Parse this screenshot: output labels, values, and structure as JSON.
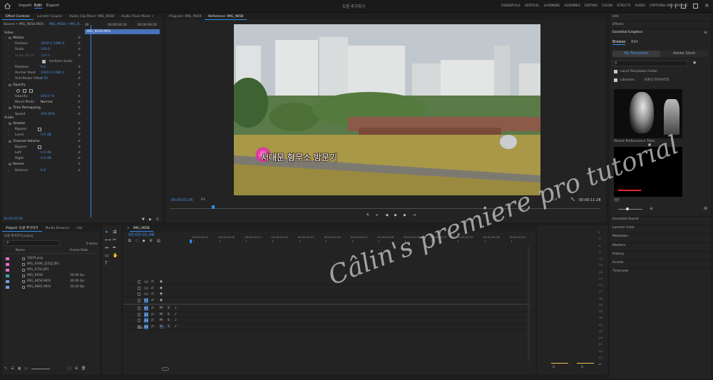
{
  "topbar": {
    "menu": [
      "Import",
      "Edit",
      "Export"
    ],
    "active_menu": "Edit",
    "project_title": "도원 추가하기",
    "workspaces": [
      "ESSENTIALS",
      "VERTICAL",
      "LEARNING",
      "ASSEMBLY",
      "EDITING",
      "COLOR",
      "EFFECTS",
      "AUDIO",
      "CAPTIONS AND GRAPHIC"
    ]
  },
  "effect_controls": {
    "tabs": [
      "Effect Controls",
      "Lumetri Scopes",
      "Audio Clip Mixer: IMG_9658",
      "Audio Track Mixer: I"
    ],
    "source": "Source • IMG_9658.MOV",
    "sequence": "IMG_9658 • IMG_9...",
    "time_start": "00",
    "time_mid": "00:00:04:24",
    "time_end": "00:00:09:29",
    "clip_name": "IMG_9658.MOV",
    "video_header": "Video",
    "rows": [
      {
        "label": "Motion",
        "value": "",
        "indent": 1,
        "fx": true
      },
      {
        "label": "Position",
        "value": "1920.0  1080.0",
        "indent": 3
      },
      {
        "label": "Scale",
        "value": "100.0",
        "indent": 3
      },
      {
        "label": "Scale Width",
        "value": "100.0",
        "indent": 3,
        "dim": true
      },
      {
        "label": "Uniform Scale",
        "value": "",
        "indent": 8,
        "check": true
      },
      {
        "label": "Rotation",
        "value": "0.0",
        "indent": 3
      },
      {
        "label": "Anchor Point",
        "value": "1920.0  1080.0",
        "indent": 3
      },
      {
        "label": "Anti-flicker Filter",
        "value": "0.00",
        "indent": 3
      },
      {
        "label": "Opacity",
        "value": "",
        "indent": 1,
        "fx": true
      },
      {
        "label": "",
        "value": "",
        "indent": 3,
        "masks": true
      },
      {
        "label": "Opacity",
        "value": "100.0 %",
        "indent": 3
      },
      {
        "label": "Blend Mode",
        "value": "Normal",
        "indent": 3
      },
      {
        "label": "Time Remapping",
        "value": "",
        "indent": 1,
        "fx": true
      },
      {
        "label": "Speed",
        "value": "100.00%",
        "indent": 3
      }
    ],
    "audio_header": "Audio",
    "audio_rows": [
      {
        "label": "Volume",
        "value": "",
        "indent": 1,
        "fx": true
      },
      {
        "label": "Bypass",
        "value": "",
        "indent": 3,
        "check": true
      },
      {
        "label": "Level",
        "value": "0.0 dB",
        "indent": 3
      },
      {
        "label": "Channel Volume",
        "value": "",
        "indent": 1,
        "fx": true
      },
      {
        "label": "Bypass",
        "value": "",
        "indent": 3,
        "check": true
      },
      {
        "label": "Left",
        "value": "0.0 dB",
        "indent": 3
      },
      {
        "label": "Right",
        "value": "0.0 dB",
        "indent": 3
      },
      {
        "label": "Panner",
        "value": "",
        "indent": 1,
        "fx": true
      },
      {
        "label": "Balance",
        "value": "0.0",
        "indent": 3
      }
    ],
    "footer_time": "00:00:01:06"
  },
  "program": {
    "tabs": [
      "Program: IMG_9658",
      "Reference: IMG_9658"
    ],
    "caption": "서대문 형무소 방문기",
    "timecode": "00:00:01:06",
    "fit": "Fit",
    "scale": "1/4",
    "duration": "00:00:11:28"
  },
  "right_panel": {
    "sections": [
      "Info",
      "Effects",
      "Essential Graphics"
    ],
    "tabs": [
      "Browse",
      "Edit"
    ],
    "subtabs": [
      "My Templates",
      "Adobe Stock"
    ],
    "local_templates": "Local Templates Folder",
    "libraries": "Libraries",
    "library_name": "조원의 라이브러리",
    "template1": "Fitness Performance Titles",
    "template2": "영문",
    "bottom_sections": [
      "Essential Sound",
      "Lumetri Color",
      "Metadata",
      "Markers",
      "History",
      "Events",
      "Timecode"
    ]
  },
  "project": {
    "tabs": [
      "Project: 도원 추가하기",
      "Media Browser",
      "Libr"
    ],
    "file": "도원 추가하기.prproj",
    "items_count": "6 items",
    "col_name": "Name",
    "col_rate": "Frame Rate",
    "items": [
      {
        "name": "자료파 png",
        "rate": "",
        "color": "#e070c8"
      },
      {
        "name": "IMG_9396_몽조합.JPG",
        "rate": "",
        "color": "#e070c8"
      },
      {
        "name": "IMG_9702.JPG",
        "rate": "",
        "color": "#e070c8"
      },
      {
        "name": "IMG_9658",
        "rate": "30.00 fps",
        "color": "#3aa8a8"
      },
      {
        "name": "IMG_9658.MOV",
        "rate": "30.00 fps",
        "color": "#7a9be0"
      },
      {
        "name": "IMG_9681.MOV",
        "rate": "30.00 fps",
        "color": "#7a9be0"
      }
    ]
  },
  "timeline": {
    "sequence_tab": "IMG_9658",
    "timecode": "00:00:01:06",
    "ruler_marks": [
      "00:00:04:15",
      "00:00:04:18",
      "00:00:04:21",
      "00:00:04:24",
      "00:00:04:27",
      "00:00:05:00",
      "00:00:05:03",
      "00:00:05:06",
      "00:00:05:09",
      "00:00:05:12",
      "00:00:05:15",
      "00:00:05:18",
      "00:00:05:21"
    ],
    "video_tracks": [
      "V4",
      "V3",
      "V2",
      "V1"
    ],
    "audio_tracks": [
      "A1",
      "A2",
      "A3",
      "A4"
    ],
    "mix_label": "Mix",
    "mix_value": "0.0"
  },
  "audio_meter": {
    "scale": [
      "0",
      "-3",
      "-6",
      "-9",
      "-12",
      "-15",
      "-18",
      "-21",
      "-24",
      "-27",
      "-30",
      "-33",
      "-36",
      "-39",
      "-42",
      "-45",
      "-48",
      "-51",
      "-54",
      "-57",
      "dB"
    ],
    "channels": [
      "S",
      "S"
    ]
  },
  "watermark": "Câlin's premiere pro tutorial",
  "colors": {
    "accent": "#2d8ceb",
    "panel": "#232323",
    "bg": "#1d1d1d"
  }
}
